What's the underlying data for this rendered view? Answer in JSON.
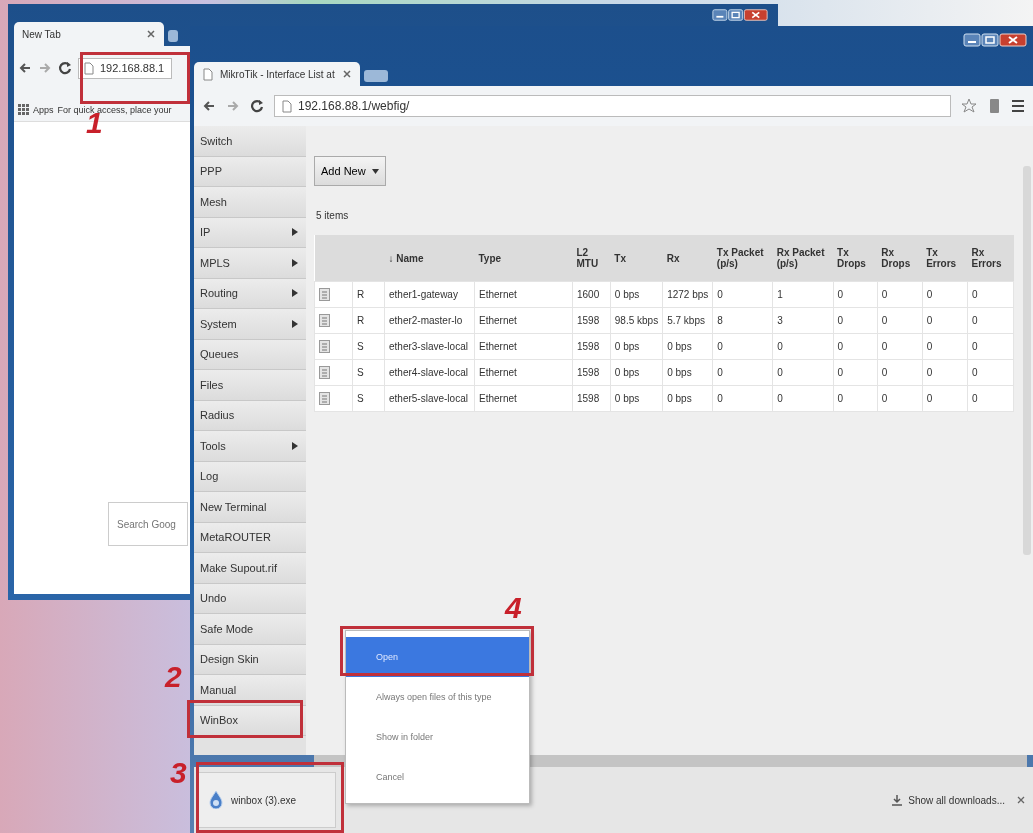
{
  "back_window": {
    "tab": "New Tab",
    "address": "192.168.88.1",
    "bookmarks": {
      "apps": "Apps",
      "message": "For quick access, place your"
    },
    "search": {
      "placeholder": "Search Goog"
    }
  },
  "front_window": {
    "tab": "MikroTik - Interface List at",
    "address": "192.168.88.1/webfig/"
  },
  "sidebar": {
    "items": [
      {
        "label": "Switch",
        "submenu": false
      },
      {
        "label": "PPP",
        "submenu": false
      },
      {
        "label": "Mesh",
        "submenu": false
      },
      {
        "label": "IP",
        "submenu": true
      },
      {
        "label": "MPLS",
        "submenu": true
      },
      {
        "label": "Routing",
        "submenu": true
      },
      {
        "label": "System",
        "submenu": true
      },
      {
        "label": "Queues",
        "submenu": false
      },
      {
        "label": "Files",
        "submenu": false
      },
      {
        "label": "Radius",
        "submenu": false
      },
      {
        "label": "Tools",
        "submenu": true
      },
      {
        "label": "Log",
        "submenu": false
      },
      {
        "label": "New Terminal",
        "submenu": false
      },
      {
        "label": "MetaROUTER",
        "submenu": false
      },
      {
        "label": "Make Supout.rif",
        "submenu": false
      },
      {
        "label": "Undo",
        "submenu": false
      },
      {
        "label": "Safe Mode",
        "submenu": false
      },
      {
        "label": "Design Skin",
        "submenu": false
      },
      {
        "label": "Manual",
        "submenu": false
      },
      {
        "label": "WinBox",
        "submenu": false
      }
    ]
  },
  "toolbar": {
    "add_button": "Add New"
  },
  "item_count": "5 items",
  "table": {
    "columns": [
      "↓ Name",
      "Type",
      "L2 MTU",
      "Tx",
      "Rx",
      "Tx Packet (p/s)",
      "Rx Packet (p/s)",
      "Tx Drops",
      "Rx Drops",
      "Tx Errors",
      "Rx Errors"
    ],
    "rows": [
      {
        "flag": "R",
        "cells": [
          "ether1-gateway",
          "Ethernet",
          "1600",
          "0 bps",
          "1272 bps",
          "0",
          "1",
          "0",
          "0",
          "0",
          "0"
        ]
      },
      {
        "flag": "R",
        "cells": [
          "ether2-master-lo",
          "Ethernet",
          "1598",
          "98.5 kbps",
          "5.7 kbps",
          "8",
          "3",
          "0",
          "0",
          "0",
          "0"
        ]
      },
      {
        "flag": "S",
        "cells": [
          "ether3-slave-local",
          "Ethernet",
          "1598",
          "0 bps",
          "0 bps",
          "0",
          "0",
          "0",
          "0",
          "0",
          "0"
        ]
      },
      {
        "flag": "S",
        "cells": [
          "ether4-slave-local",
          "Ethernet",
          "1598",
          "0 bps",
          "0 bps",
          "0",
          "0",
          "0",
          "0",
          "0",
          "0"
        ]
      },
      {
        "flag": "S",
        "cells": [
          "ether5-slave-local",
          "Ethernet",
          "1598",
          "0 bps",
          "0 bps",
          "0",
          "0",
          "0",
          "0",
          "0",
          "0"
        ]
      }
    ]
  },
  "context_menu": {
    "items": [
      {
        "label": "Open",
        "selected": true
      },
      {
        "label": "Always open files of this type",
        "selected": false
      },
      {
        "label": "Show in folder",
        "selected": false
      },
      {
        "label": "Cancel",
        "selected": false
      }
    ]
  },
  "download_bar": {
    "item": "winbox (3).exe",
    "show_all": "Show all downloads..."
  },
  "annotations": [
    "1",
    "2",
    "3",
    "4"
  ]
}
